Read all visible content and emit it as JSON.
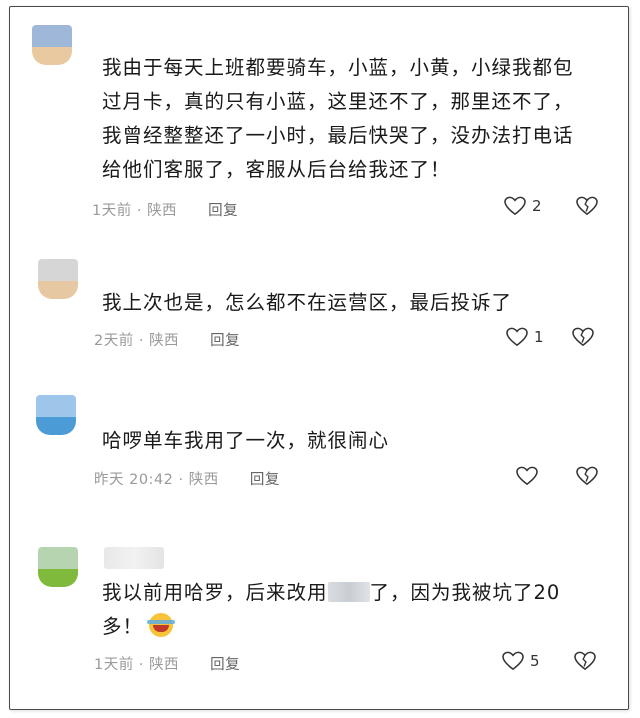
{
  "comments": [
    {
      "text_lines": [
        "我由于每天上班都要骑车，小蓝，小黄，小绿我都包",
        "过月卡，真的只有小蓝，这里还不了，那里还不了，",
        "我曾经整整还了一小时，最后快哭了，没办法打电话",
        "给他们客服了，客服从后台给我还了！"
      ],
      "time": "1天前",
      "sep": "·",
      "location": "陕西",
      "reply_label": "回复",
      "likes": "2",
      "avatar_top": "#9fb7d9",
      "avatar_bottom": "#e8c9a0"
    },
    {
      "text_lines": [
        "我上次也是，怎么都不在运营区，最后投诉了"
      ],
      "time": "2天前",
      "sep": "·",
      "location": "陕西",
      "reply_label": "回复",
      "likes": "1",
      "avatar_top": "#d6d6d6",
      "avatar_bottom": "#e6c9a3"
    },
    {
      "text_lines": [
        "哈啰单车我用了一次，就很闹心"
      ],
      "time": "昨天 20:42",
      "sep": "·",
      "location": "陕西",
      "reply_label": "回复",
      "likes": "",
      "avatar_top": "#9ec5ea",
      "avatar_bottom": "#4a9bd6"
    },
    {
      "text_line1_before": "我以前用哈罗，后来改用",
      "text_line1_after": "了，因为我被坑了20",
      "text_line2": "多！",
      "time": "1天前",
      "sep": "·",
      "location": "陕西",
      "reply_label": "回复",
      "likes": "5",
      "avatar_top": "#b7d4b0",
      "avatar_bottom": "#7fba3c"
    }
  ]
}
